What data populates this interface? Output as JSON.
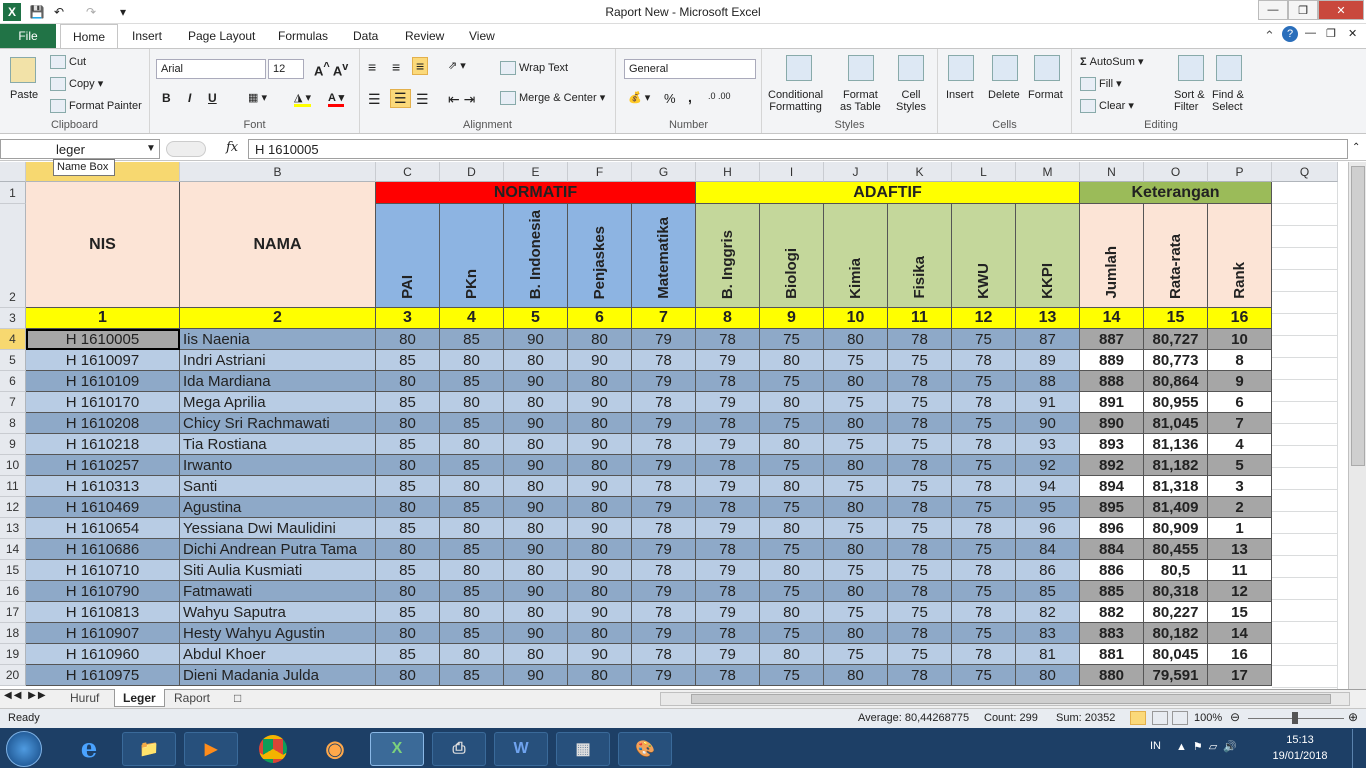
{
  "window": {
    "title": "Raport New  -  Microsoft Excel"
  },
  "tabs": [
    "File",
    "Home",
    "Insert",
    "Page Layout",
    "Formulas",
    "Data",
    "Review",
    "View"
  ],
  "active_tab": "Home",
  "ribbon": {
    "clipboard": {
      "paste": "Paste",
      "cut": "Cut",
      "copy": "Copy",
      "format_painter": "Format Painter",
      "label": "Clipboard"
    },
    "font": {
      "name": "Arial",
      "size": "12",
      "bold": "B",
      "italic": "I",
      "underline": "U",
      "label": "Font"
    },
    "alignment": {
      "wrap": "Wrap Text",
      "merge": "Merge & Center",
      "label": "Alignment"
    },
    "number": {
      "format": "General",
      "percent": "%",
      "comma": ",",
      "label": "Number"
    },
    "styles": {
      "conditional": "Conditional\nFormatting",
      "format_table": "Format\nas Table",
      "cell_styles": "Cell\nStyles",
      "label": "Styles"
    },
    "cells": {
      "insert": "Insert",
      "delete": "Delete",
      "format": "Format",
      "label": "Cells"
    },
    "editing": {
      "autosum": "AutoSum",
      "fill": "Fill",
      "clear": "Clear",
      "sort": "Sort &\nFilter",
      "find": "Find &\nSelect",
      "label": "Editing"
    }
  },
  "formula_bar": {
    "name_box": "leger",
    "fx": "fx",
    "value": "H 1610005",
    "tooltip": "Name Box"
  },
  "columns": [
    "",
    "B",
    "C",
    "D",
    "E",
    "F",
    "G",
    "H",
    "I",
    "J",
    "K",
    "L",
    "M",
    "N",
    "O",
    "P",
    "Q"
  ],
  "header": {
    "nis": "NIS",
    "nama": "NAMA",
    "normatif": "NORMATIF",
    "adaftif": "ADAFTIF",
    "keterangan": "Keterangan",
    "subjects": [
      "PAI",
      "PKn",
      "B. Indonesia",
      "Penjaskes",
      "Matematika",
      "B. Inggris",
      "Biologi",
      "Kimia",
      "Fisika",
      "KWU",
      "KKPI"
    ],
    "summary": [
      "Jumlah",
      "Rata-rata",
      "Rank"
    ],
    "numbers": [
      "1",
      "2",
      "3",
      "4",
      "5",
      "6",
      "7",
      "8",
      "9",
      "10",
      "11",
      "12",
      "13",
      "14",
      "15",
      "16"
    ]
  },
  "rows": [
    {
      "r": "4",
      "nis": "H 1610005",
      "nama": "Iis Naenia",
      "v": [
        "80",
        "85",
        "90",
        "80",
        "79",
        "78",
        "75",
        "80",
        "78",
        "75",
        "87"
      ],
      "jumlah": "887",
      "rata": "80,727",
      "rank": "10"
    },
    {
      "r": "5",
      "nis": "H 1610097",
      "nama": "Indri Astriani",
      "v": [
        "85",
        "80",
        "80",
        "90",
        "78",
        "79",
        "80",
        "75",
        "75",
        "78",
        "89"
      ],
      "jumlah": "889",
      "rata": "80,773",
      "rank": "8"
    },
    {
      "r": "6",
      "nis": "H 1610109",
      "nama": "Ida Mardiana",
      "v": [
        "80",
        "85",
        "90",
        "80",
        "79",
        "78",
        "75",
        "80",
        "78",
        "75",
        "88"
      ],
      "jumlah": "888",
      "rata": "80,864",
      "rank": "9"
    },
    {
      "r": "7",
      "nis": "H 1610170",
      "nama": "Mega Aprilia",
      "v": [
        "85",
        "80",
        "80",
        "90",
        "78",
        "79",
        "80",
        "75",
        "75",
        "78",
        "91"
      ],
      "jumlah": "891",
      "rata": "80,955",
      "rank": "6"
    },
    {
      "r": "8",
      "nis": "H 1610208",
      "nama": "Chicy Sri Rachmawati",
      "v": [
        "80",
        "85",
        "90",
        "80",
        "79",
        "78",
        "75",
        "80",
        "78",
        "75",
        "90"
      ],
      "jumlah": "890",
      "rata": "81,045",
      "rank": "7"
    },
    {
      "r": "9",
      "nis": "H 1610218",
      "nama": "Tia Rostiana",
      "v": [
        "85",
        "80",
        "80",
        "90",
        "78",
        "79",
        "80",
        "75",
        "75",
        "78",
        "93"
      ],
      "jumlah": "893",
      "rata": "81,136",
      "rank": "4"
    },
    {
      "r": "10",
      "nis": "H 1610257",
      "nama": "Irwanto",
      "v": [
        "80",
        "85",
        "90",
        "80",
        "79",
        "78",
        "75",
        "80",
        "78",
        "75",
        "92"
      ],
      "jumlah": "892",
      "rata": "81,182",
      "rank": "5"
    },
    {
      "r": "11",
      "nis": "H 1610313",
      "nama": "Santi",
      "v": [
        "85",
        "80",
        "80",
        "90",
        "78",
        "79",
        "80",
        "75",
        "75",
        "78",
        "94"
      ],
      "jumlah": "894",
      "rata": "81,318",
      "rank": "3"
    },
    {
      "r": "12",
      "nis": "H 1610469",
      "nama": "Agustina",
      "v": [
        "80",
        "85",
        "90",
        "80",
        "79",
        "78",
        "75",
        "80",
        "78",
        "75",
        "95"
      ],
      "jumlah": "895",
      "rata": "81,409",
      "rank": "2"
    },
    {
      "r": "13",
      "nis": "H 1610654",
      "nama": "Yessiana Dwi Maulidini",
      "v": [
        "85",
        "80",
        "80",
        "90",
        "78",
        "79",
        "80",
        "75",
        "75",
        "78",
        "96"
      ],
      "jumlah": "896",
      "rata": "80,909",
      "rank": "1"
    },
    {
      "r": "14",
      "nis": "H 1610686",
      "nama": "Dichi Andrean Putra Tama",
      "v": [
        "80",
        "85",
        "90",
        "80",
        "79",
        "78",
        "75",
        "80",
        "78",
        "75",
        "84"
      ],
      "jumlah": "884",
      "rata": "80,455",
      "rank": "13"
    },
    {
      "r": "15",
      "nis": "H 1610710",
      "nama": "Siti Aulia Kusmiati",
      "v": [
        "85",
        "80",
        "80",
        "90",
        "78",
        "79",
        "80",
        "75",
        "75",
        "78",
        "86"
      ],
      "jumlah": "886",
      "rata": "80,5",
      "rank": "11"
    },
    {
      "r": "16",
      "nis": "H 1610790",
      "nama": "Fatmawati",
      "v": [
        "80",
        "85",
        "90",
        "80",
        "79",
        "78",
        "75",
        "80",
        "78",
        "75",
        "85"
      ],
      "jumlah": "885",
      "rata": "80,318",
      "rank": "12"
    },
    {
      "r": "17",
      "nis": "H 1610813",
      "nama": "Wahyu Saputra",
      "v": [
        "85",
        "80",
        "80",
        "90",
        "78",
        "79",
        "80",
        "75",
        "75",
        "78",
        "82"
      ],
      "jumlah": "882",
      "rata": "80,227",
      "rank": "15"
    },
    {
      "r": "18",
      "nis": "H 1610907",
      "nama": "Hesty Wahyu Agustin",
      "v": [
        "80",
        "85",
        "90",
        "80",
        "79",
        "78",
        "75",
        "80",
        "78",
        "75",
        "83"
      ],
      "jumlah": "883",
      "rata": "80,182",
      "rank": "14"
    },
    {
      "r": "19",
      "nis": "H 1610960",
      "nama": "Abdul Khoer",
      "v": [
        "85",
        "80",
        "80",
        "90",
        "78",
        "79",
        "80",
        "75",
        "75",
        "78",
        "81"
      ],
      "jumlah": "881",
      "rata": "80,045",
      "rank": "16"
    },
    {
      "r": "20",
      "nis": "H 1610975",
      "nama": "Dieni Madania Julda",
      "v": [
        "80",
        "85",
        "90",
        "80",
        "79",
        "78",
        "75",
        "80",
        "78",
        "75",
        "80"
      ],
      "jumlah": "880",
      "rata": "79,591",
      "rank": "17"
    }
  ],
  "sheet_tabs": [
    "Huruf",
    "Leger",
    "Raport"
  ],
  "active_sheet": "Leger",
  "status": {
    "ready": "Ready",
    "average": "Average: 80,44268775",
    "count": "Count: 299",
    "sum": "Sum: 20352",
    "zoom": "100%"
  },
  "taskbar": {
    "lang": "IN",
    "time": "15:13",
    "date": "19/01/2018"
  },
  "colors": {
    "red": "#ff0000",
    "yellow": "#ffff00",
    "green": "#9bbb59",
    "peach": "#fce4d6",
    "blue_hdr": "#8db4e2",
    "green_hdr": "#c4d79b",
    "row_dark": "#8ea9c8",
    "row_light": "#b8cce4",
    "gray": "#a6a6a6"
  }
}
